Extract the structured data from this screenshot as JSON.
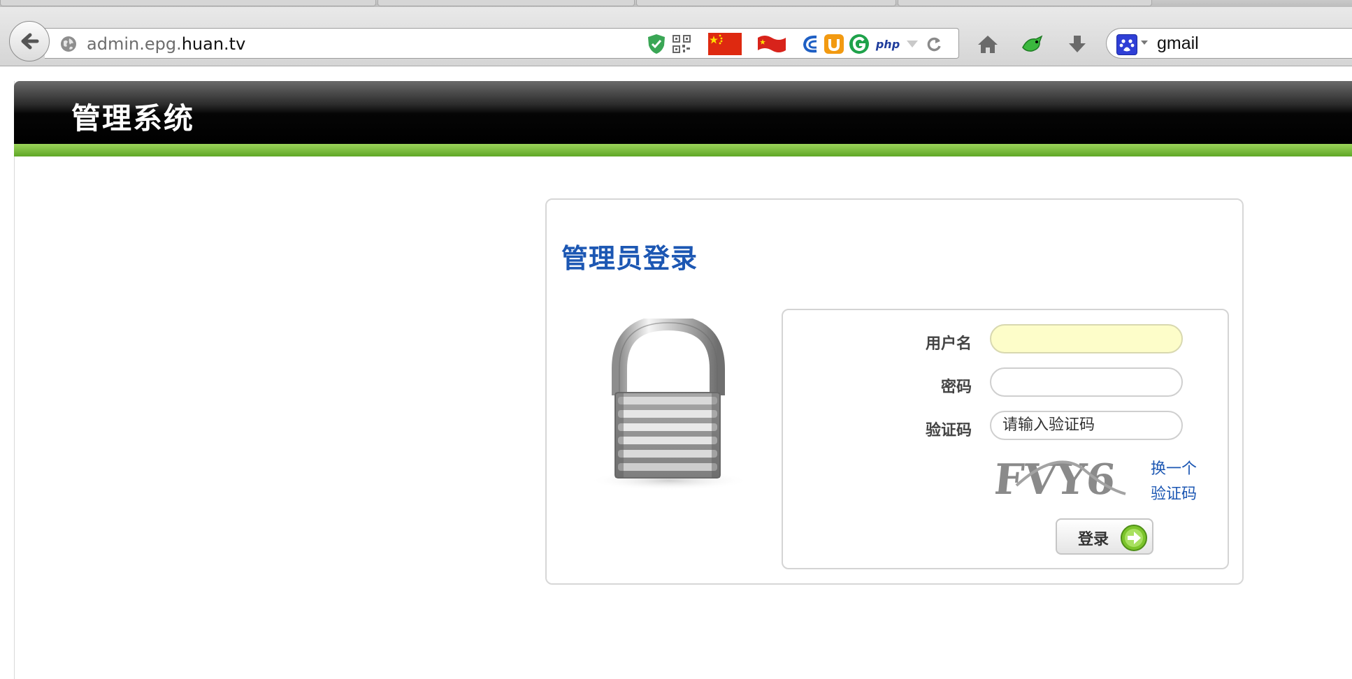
{
  "browser": {
    "url_prefix": "admin.epg.",
    "url_host": "huan.tv",
    "search_text": "gmail",
    "icons": [
      "back-arrow-icon",
      "globe-icon",
      "shield-icon",
      "qr-code-icon",
      "china-flag-icon",
      "china-flag-wave-icon",
      "swirl-icon",
      "u-logo-icon",
      "g-logo-icon",
      "php-icon",
      "dropdown-icon",
      "reload-icon",
      "home-icon",
      "green-bird-icon",
      "download-icon",
      "baidu-paw-icon"
    ],
    "php_label": "php"
  },
  "site": {
    "title": "管理系统"
  },
  "login": {
    "title": "管理员登录",
    "username_label": "用户名",
    "username_value": "",
    "password_label": "密码",
    "password_value": "",
    "captcha_label": "验证码",
    "captcha_placeholder": "请输入验证码",
    "captcha_text": "FVY6",
    "refresh_line1": "换一个",
    "refresh_line2": "验证码",
    "submit_label": "登录"
  },
  "colors": {
    "header_green": "#6db336",
    "title_blue": "#1c57b3",
    "input_focus": "#fdfdc9"
  }
}
